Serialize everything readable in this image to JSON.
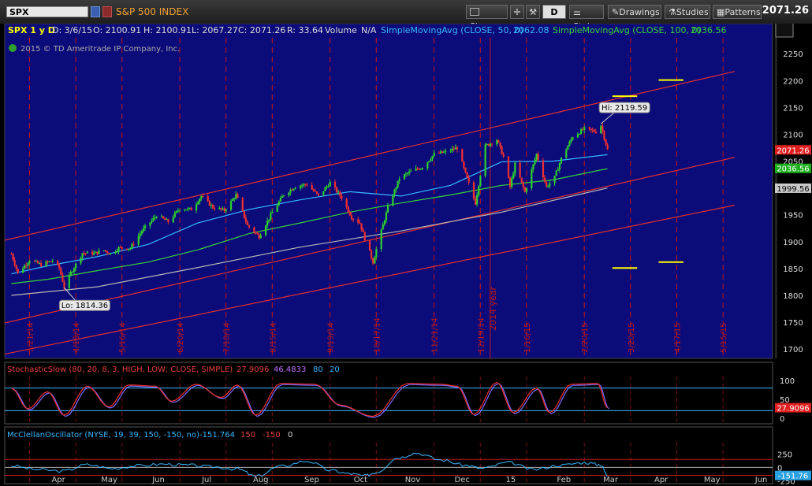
{
  "toolbar": {
    "symbol": "SPX",
    "index_name": "S&P 500 INDEX",
    "share": "Share",
    "period": "D",
    "style": "Style",
    "drawings": "Drawings",
    "studies": "Studies",
    "patterns": "Patterns",
    "last_price": "2071.26"
  },
  "header": {
    "title": "SPX 1 y D",
    "date": "D: 3/6/15",
    "open": "O: 2100.91",
    "high": "H: 2100.91",
    "low": "L: 2067.27",
    "close": "C: 2071.26",
    "range": "R: 33.64",
    "volume": "Volume",
    "volume_val": "N/A",
    "sma50_label": "SimpleMovingAvg (CLOSE, 50, 0)",
    "sma50_val": "2062.08",
    "sma100_label": "SimpleMovingAvg (CLOSE, 100, 0)",
    "sma100_val": "2036.56",
    "copyright": "2015 © TD Ameritrade IP Company, Inc."
  },
  "colors": {
    "panel_bg": "#0b0b7a",
    "grid_red": "#c01818",
    "channel": "#e03030",
    "sma50": "#38b8ff",
    "sma100": "#3ad23a",
    "sma200": "#b8b8b8",
    "up": "#2fd12f",
    "down": "#f03030",
    "stoch_k": "#f03030",
    "stoch_d": "#7a6cff",
    "mcclellan": "#3ab8ff",
    "yellow": "#ffff00"
  },
  "chart_data": [
    {
      "type": "candlestick",
      "title": "SPX 1 y D",
      "ylim": [
        1690,
        2265
      ],
      "yticks": [
        1700,
        1750,
        1800,
        1850,
        1900,
        1950,
        2000,
        2050,
        2100,
        2150,
        2200,
        2250
      ],
      "vertical_date_labels": [
        "3/21/14",
        "4/18/14",
        "5/16/14",
        "6/20/14",
        "7/18/14",
        "8/15/14",
        "9/19/14",
        "10/17/14",
        "11/21/14",
        "12/19/14",
        "1/16/15",
        "2/20/15",
        "3/20/15",
        "4/17/15",
        "5/15/15"
      ],
      "year_label": "2014 year",
      "month_labels": [
        "Apr",
        "May",
        "Jun",
        "Jul",
        "Aug",
        "Sep",
        "Oct",
        "Nov",
        "Dec",
        "15",
        "Feb",
        "Mar",
        "Apr",
        "May",
        "Jun"
      ],
      "price_path": [
        [
          "2014-03-10",
          1877
        ],
        [
          "2014-03-14",
          1841
        ],
        [
          "2014-03-21",
          1866
        ],
        [
          "2014-03-28",
          1857
        ],
        [
          "2014-04-04",
          1865
        ],
        [
          "2014-04-08",
          1851
        ],
        [
          "2014-04-11",
          1815
        ],
        [
          "2014-04-15",
          1842
        ],
        [
          "2014-04-22",
          1879
        ],
        [
          "2014-04-29",
          1878
        ],
        [
          "2014-05-05",
          1884
        ],
        [
          "2014-05-09",
          1878
        ],
        [
          "2014-05-14",
          1888
        ],
        [
          "2014-05-21",
          1888
        ],
        [
          "2014-05-28",
          1920
        ],
        [
          "2014-06-06",
          1949
        ],
        [
          "2014-06-13",
          1937
        ],
        [
          "2014-06-20",
          1962
        ],
        [
          "2014-06-27",
          1960
        ],
        [
          "2014-07-03",
          1985
        ],
        [
          "2014-07-10",
          1964
        ],
        [
          "2014-07-17",
          1958
        ],
        [
          "2014-07-24",
          1987
        ],
        [
          "2014-07-31",
          1930
        ],
        [
          "2014-08-07",
          1910
        ],
        [
          "2014-08-15",
          1955
        ],
        [
          "2014-08-22",
          1988
        ],
        [
          "2014-08-29",
          2003
        ],
        [
          "2014-09-05",
          2007
        ],
        [
          "2014-09-12",
          1985
        ],
        [
          "2014-09-19",
          2010
        ],
        [
          "2014-09-26",
          1982
        ],
        [
          "2014-10-02",
          1946
        ],
        [
          "2014-10-07",
          1935
        ],
        [
          "2014-10-10",
          1906
        ],
        [
          "2014-10-15",
          1862
        ],
        [
          "2014-10-17",
          1886
        ],
        [
          "2014-10-24",
          1964
        ],
        [
          "2014-10-31",
          2018
        ],
        [
          "2014-11-07",
          2031
        ],
        [
          "2014-11-14",
          2039
        ],
        [
          "2014-11-21",
          2063
        ],
        [
          "2014-11-28",
          2067
        ],
        [
          "2014-12-05",
          2075
        ],
        [
          "2014-12-10",
          2026
        ],
        [
          "2014-12-16",
          1972
        ],
        [
          "2014-12-22",
          2078
        ],
        [
          "2014-12-29",
          2090
        ],
        [
          "2015-01-02",
          2058
        ],
        [
          "2015-01-06",
          2002
        ],
        [
          "2015-01-09",
          2044
        ],
        [
          "2015-01-15",
          1992
        ],
        [
          "2015-01-22",
          2063
        ],
        [
          "2015-01-28",
          2002
        ],
        [
          "2015-02-02",
          2020
        ],
        [
          "2015-02-06",
          2055
        ],
        [
          "2015-02-13",
          2096
        ],
        [
          "2015-02-20",
          2110
        ],
        [
          "2015-02-27",
          2105
        ],
        [
          "2015-03-02",
          2117
        ],
        [
          "2015-03-06",
          2071
        ]
      ],
      "series": [
        {
          "name": "SimpleMovingAvg (CLOSE, 50, 0)",
          "last": 2062.08,
          "path": [
            [
              "2014-03-10",
              1840
            ],
            [
              "2014-04-01",
              1855
            ],
            [
              "2014-05-01",
              1872
            ],
            [
              "2014-06-01",
              1895
            ],
            [
              "2014-07-01",
              1935
            ],
            [
              "2014-08-01",
              1960
            ],
            [
              "2014-09-01",
              1978
            ],
            [
              "2014-10-01",
              1993
            ],
            [
              "2014-11-01",
              1985
            ],
            [
              "2014-12-01",
              2005
            ],
            [
              "2015-01-01",
              2049
            ],
            [
              "2015-02-01",
              2050
            ],
            [
              "2015-03-06",
              2062
            ]
          ]
        },
        {
          "name": "SimpleMovingAvg (CLOSE, 100, 0)",
          "last": 2036.56,
          "path": [
            [
              "2014-03-10",
              1822
            ],
            [
              "2014-04-01",
              1830
            ],
            [
              "2014-05-01",
              1846
            ],
            [
              "2014-06-01",
              1862
            ],
            [
              "2014-07-01",
              1885
            ],
            [
              "2014-08-01",
              1915
            ],
            [
              "2014-09-01",
              1935
            ],
            [
              "2014-10-01",
              1955
            ],
            [
              "2014-11-01",
              1972
            ],
            [
              "2014-12-01",
              1987
            ],
            [
              "2015-01-01",
              2005
            ],
            [
              "2015-02-01",
              2015
            ],
            [
              "2015-03-06",
              2036
            ]
          ]
        },
        {
          "name": "",
          "last": 1999.56,
          "path": [
            [
              "2014-03-10",
              1800
            ],
            [
              "2014-05-01",
              1816
            ],
            [
              "2014-07-01",
              1852
            ],
            [
              "2014-09-01",
              1890
            ],
            [
              "2014-11-01",
              1920
            ],
            [
              "2015-01-01",
              1955
            ],
            [
              "2015-03-06",
              2000
            ]
          ]
        }
      ],
      "channel_lines": [
        [
          [
            "2014-03-05",
            1902
          ],
          [
            "2015-05-22",
            2217
          ]
        ],
        [
          [
            "2014-03-05",
            1748
          ],
          [
            "2015-05-22",
            2057
          ]
        ],
        [
          [
            "2014-03-05",
            1690
          ],
          [
            "2015-05-22",
            1968
          ]
        ]
      ],
      "price_labels": [
        "2071.26",
        "2036.56",
        "1999.56"
      ],
      "annotations": [
        {
          "text": "Hi: 2119.59",
          "date": "2015-03-02",
          "value": 2119.59
        },
        {
          "text": "Lo: 1814.36",
          "date": "2014-04-11",
          "value": 1814.36
        }
      ],
      "yellow_marks": [
        {
          "start": "2015-03-09",
          "end": "2015-03-24",
          "value": 2171
        },
        {
          "start": "2015-04-06",
          "end": "2015-04-21",
          "value": 2201
        },
        {
          "start": "2015-03-09",
          "end": "2015-03-24",
          "value": 1851
        },
        {
          "start": "2015-04-06",
          "end": "2015-04-21",
          "value": 1862
        }
      ]
    },
    {
      "type": "line",
      "title": "StochasticSlow (80, 20, 8, 3, HIGH, LOW, CLOSE, SIMPLE)",
      "values_text": [
        "27.9096",
        "46.4833",
        "80",
        "20"
      ],
      "ylim": [
        0,
        100
      ],
      "yticks": [
        0,
        50,
        100
      ],
      "levels": [
        80,
        20
      ],
      "last": 27.9096,
      "series": [
        {
          "name": "",
          "path": [
            [
              "2014-03-10",
              80
            ],
            [
              "2014-03-20",
              25
            ],
            [
              "2014-04-01",
              70
            ],
            [
              "2014-04-11",
              8
            ],
            [
              "2014-04-25",
              85
            ],
            [
              "2014-05-08",
              30
            ],
            [
              "2014-05-20",
              88
            ],
            [
              "2014-06-05",
              85
            ],
            [
              "2014-06-15",
              45
            ],
            [
              "2014-06-30",
              90
            ],
            [
              "2014-07-15",
              55
            ],
            [
              "2014-07-25",
              88
            ],
            [
              "2014-08-05",
              8
            ],
            [
              "2014-08-20",
              92
            ],
            [
              "2014-09-10",
              90
            ],
            [
              "2014-09-25",
              35
            ],
            [
              "2014-10-15",
              5
            ],
            [
              "2014-11-05",
              92
            ],
            [
              "2014-11-25",
              90
            ],
            [
              "2014-12-05",
              85
            ],
            [
              "2014-12-15",
              10
            ],
            [
              "2014-12-29",
              95
            ],
            [
              "2015-01-08",
              15
            ],
            [
              "2015-01-22",
              80
            ],
            [
              "2015-01-30",
              15
            ],
            [
              "2015-02-12",
              90
            ],
            [
              "2015-02-28",
              92
            ],
            [
              "2015-03-06",
              28
            ]
          ]
        }
      ]
    },
    {
      "type": "line",
      "title": "McClellanOscillator (NYSE, 19, 39, 150, -150, no)",
      "values_text": [
        "-151.764",
        "150",
        "-150",
        "0"
      ],
      "ylim": [
        -260,
        330
      ],
      "yticks": [
        -250,
        0,
        250
      ],
      "levels": [
        150,
        -150
      ],
      "last": -151.76,
      "series": [
        {
          "name": "",
          "path": [
            [
              "2014-03-10",
              30
            ],
            [
              "2014-03-25",
              -40
            ],
            [
              "2014-04-10",
              -70
            ],
            [
              "2014-04-25",
              50
            ],
            [
              "2014-05-10",
              -20
            ],
            [
              "2014-05-25",
              30
            ],
            [
              "2014-06-10",
              60
            ],
            [
              "2014-06-25",
              40
            ],
            [
              "2014-07-10",
              10
            ],
            [
              "2014-07-25",
              -30
            ],
            [
              "2014-08-05",
              -170
            ],
            [
              "2014-08-20",
              20
            ],
            [
              "2014-09-05",
              120
            ],
            [
              "2014-09-20",
              -60
            ],
            [
              "2014-10-01",
              -120
            ],
            [
              "2014-10-10",
              -160
            ],
            [
              "2014-10-17",
              -90
            ],
            [
              "2014-10-30",
              180
            ],
            [
              "2014-11-10",
              270
            ],
            [
              "2014-11-25",
              140
            ],
            [
              "2014-12-10",
              40
            ],
            [
              "2014-12-20",
              -20
            ],
            [
              "2015-01-05",
              90
            ],
            [
              "2015-01-20",
              -40
            ],
            [
              "2015-02-05",
              40
            ],
            [
              "2015-02-20",
              90
            ],
            [
              "2015-03-02",
              50
            ],
            [
              "2015-03-06",
              -152
            ]
          ]
        }
      ]
    }
  ]
}
